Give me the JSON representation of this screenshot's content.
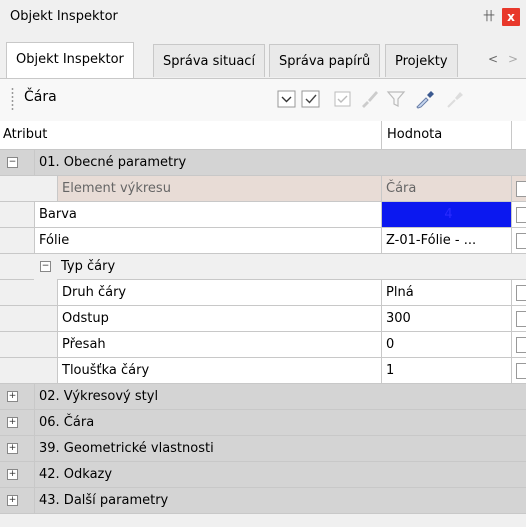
{
  "window": {
    "title": "Objekt Inspektor",
    "pin_symbol": "卄",
    "close_symbol": "x"
  },
  "tabs": [
    {
      "label": "Objekt Inspektor",
      "active": true
    },
    {
      "label": "Správa situací",
      "active": false
    },
    {
      "label": "Správa papírů",
      "active": false
    },
    {
      "label": "Projekty",
      "active": false
    }
  ],
  "tab_nav": {
    "left": "<",
    "right": ">"
  },
  "toolbar": {
    "object_label": "Čára",
    "icons": [
      "dropdown-icon",
      "checkmark-icon",
      "select-all-icon",
      "brush-icon",
      "filter-icon",
      "eyedropper-icon",
      "pick-icon"
    ]
  },
  "grid": {
    "col_attribute": "Atribut",
    "col_value": "Hodnota",
    "groups": [
      {
        "label": "01. Obecné parametry",
        "expanded": true,
        "rows": [
          {
            "name": "Element výkresu",
            "value": "Čára",
            "readonly": true
          },
          {
            "name": "Barva",
            "value": "4",
            "color": "#0b18f0"
          },
          {
            "name": "Fólie",
            "value": "Z-01-Fólie - ..."
          }
        ],
        "subgroup": {
          "label": "Typ čáry",
          "rows": [
            {
              "name": "Druh čáry",
              "value": "Plná"
            },
            {
              "name": "Odstup",
              "value": "300"
            },
            {
              "name": "Přesah",
              "value": "0"
            },
            {
              "name": "Tloušťka čáry",
              "value": "1"
            }
          ]
        }
      },
      {
        "label": "02. Výkresový styl",
        "expanded": false
      },
      {
        "label": "06. Čára",
        "expanded": false
      },
      {
        "label": "39. Geometrické vlastnosti",
        "expanded": false
      },
      {
        "label": "42. Odkazy",
        "expanded": false
      },
      {
        "label": "43. Další parametry",
        "expanded": false
      }
    ]
  }
}
